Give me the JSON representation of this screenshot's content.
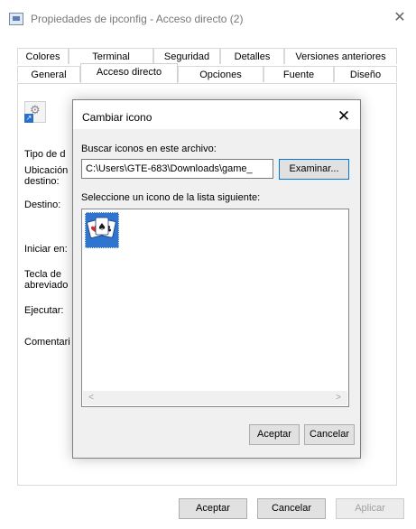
{
  "window": {
    "title": "Propiedades de ipconfig - Acceso directo (2)",
    "close_glyph": "✕"
  },
  "tabs": {
    "row1": [
      "Colores",
      "Terminal",
      "Seguridad",
      "Detalles",
      "Versiones anteriores"
    ],
    "row2": [
      "General",
      "Acceso directo",
      "Opciones",
      "Fuente",
      "Diseño"
    ],
    "active": "Acceso directo"
  },
  "behind": {
    "tipo": "Tipo de d",
    "ubicacion": "Ubicación",
    "destino_line2": "destino:",
    "destino": "Destino:",
    "iniciar": "Iniciar en:",
    "tecla": "Tecla de",
    "abreviado": "abreviado",
    "ejecutar": "Ejecutar:",
    "comentario": "Comentari"
  },
  "footer": {
    "ok": "Aceptar",
    "cancel": "Cancelar",
    "apply": "Aplicar"
  },
  "dialog": {
    "title": "Cambiar icono",
    "close_glyph": "✕",
    "search_label": "Buscar iconos en este archivo:",
    "path_value": "C:\\Users\\GTE-683\\Downloads\\game_",
    "browse": "Examinar...",
    "list_label": "Seleccione un icono de la lista siguiente:",
    "ok": "Aceptar",
    "cancel": "Cancelar",
    "scroll_left": "<",
    "scroll_right": ">"
  }
}
